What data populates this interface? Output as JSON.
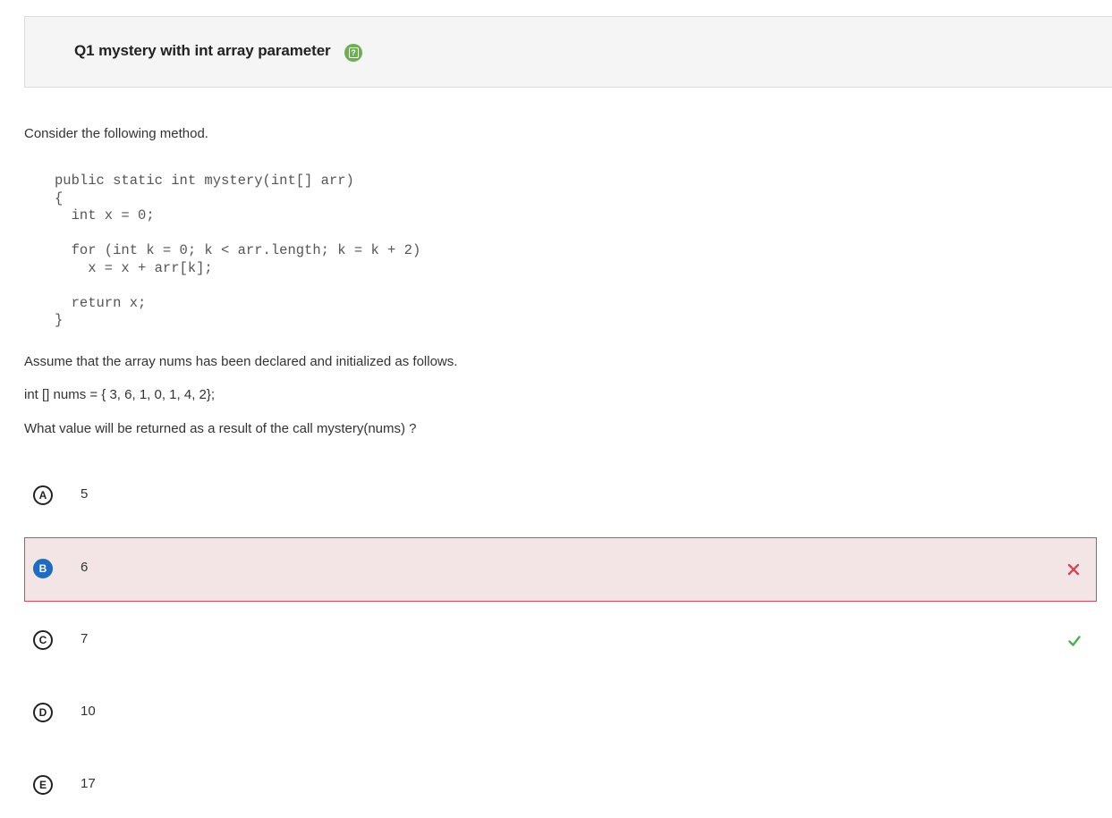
{
  "header": {
    "title": "Q1 mystery with int array parameter",
    "help_icon": "help-icon",
    "help_glyph": "?"
  },
  "intro": "Consider the following method.",
  "code": "public static int mystery(int[] arr)\n{\n  int x = 0;\n\n  for (int k = 0; k < arr.length; k = k + 2)\n    x = x + arr[k];\n\n  return x;\n}",
  "assume": "Assume that the array nums has been declared and initialized as follows.",
  "declaration": "int [] nums = { 3, 6, 1, 0, 1, 4, 2};",
  "question": "What value will be returned as a result of the call mystery(nums) ?",
  "options": [
    {
      "letter": "A",
      "value": "5"
    },
    {
      "letter": "B",
      "value": "6",
      "selected": true,
      "status": "incorrect"
    },
    {
      "letter": "C",
      "value": "7",
      "status": "correct"
    },
    {
      "letter": "D",
      "value": "10"
    },
    {
      "letter": "E",
      "value": "17"
    }
  ],
  "colors": {
    "correct": "#4caf50",
    "incorrect": "#d1485a",
    "selected_badge": "#1e6bbf",
    "selected_bg": "#f3e5e6"
  }
}
